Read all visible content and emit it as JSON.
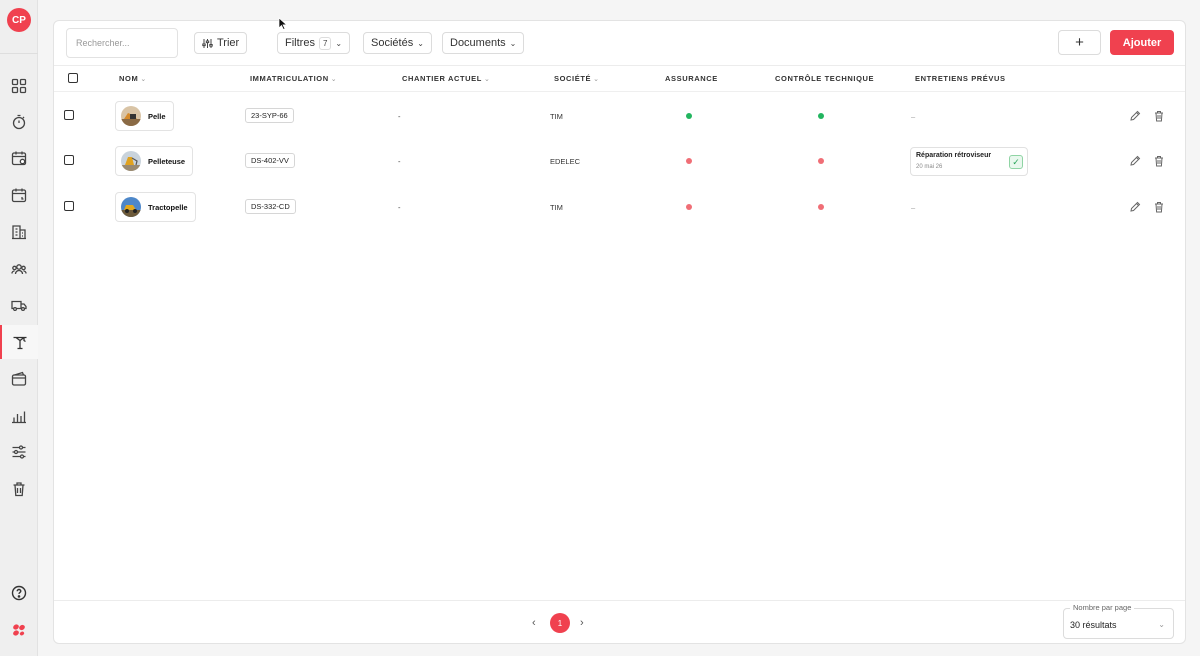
{
  "user": {
    "initials": "CP"
  },
  "sidebar": {
    "items": [
      {
        "icon": "dashboard-icon"
      },
      {
        "icon": "stopwatch-icon"
      },
      {
        "icon": "calendar-icon"
      },
      {
        "icon": "calendar-clock-icon"
      },
      {
        "icon": "building-icon"
      },
      {
        "icon": "users-icon"
      },
      {
        "icon": "truck-icon"
      },
      {
        "icon": "excavator-icon",
        "active": true
      },
      {
        "icon": "wallet-icon"
      },
      {
        "icon": "bar-chart-icon"
      },
      {
        "icon": "sliders-icon"
      },
      {
        "icon": "trash-icon"
      }
    ],
    "bottom": [
      {
        "icon": "help-icon"
      },
      {
        "icon": "brand-logo-icon"
      }
    ]
  },
  "toolbar": {
    "search_placeholder": "Rechercher...",
    "sort_label": "Trier",
    "filters_label": "Filtres",
    "filters_count": "7",
    "companies_label": "Sociétés",
    "documents_label": "Documents",
    "plus_label": "+",
    "add_label": "Ajouter"
  },
  "table": {
    "columns": {
      "name": "NOM",
      "plate": "IMMATRICULATION",
      "site": "CHANTIER ACTUEL",
      "company": "SOCIÉTÉ",
      "insurance": "ASSURANCE",
      "inspection": "CONTRÔLE TECHNIQUE",
      "maintenance": "ENTRETIENS PRÉVUS"
    },
    "rows": [
      {
        "name": "Pelle",
        "plate": "23-SYP-66",
        "site": "-",
        "company": "TIM",
        "insurance": "ok",
        "inspection": "ok",
        "maintenance": "–"
      },
      {
        "name": "Pelleteuse",
        "plate": "DS-402-VV",
        "site": "-",
        "company": "EDELEC",
        "insurance": "missing",
        "inspection": "missing",
        "maintenance_title": "Réparation rétroviseur",
        "maintenance_date": "20 mai 26"
      },
      {
        "name": "Tractopelle",
        "plate": "DS-332-CD",
        "site": "-",
        "company": "TIM",
        "insurance": "missing",
        "inspection": "missing",
        "maintenance": "–"
      }
    ]
  },
  "colors": {
    "ok": "#22b55f",
    "missing": "#f06e76",
    "accent": "#f0414f"
  },
  "pagination": {
    "current_page": "1",
    "per_page_label": "Nombre par page",
    "per_page_value": "30 résultats"
  }
}
